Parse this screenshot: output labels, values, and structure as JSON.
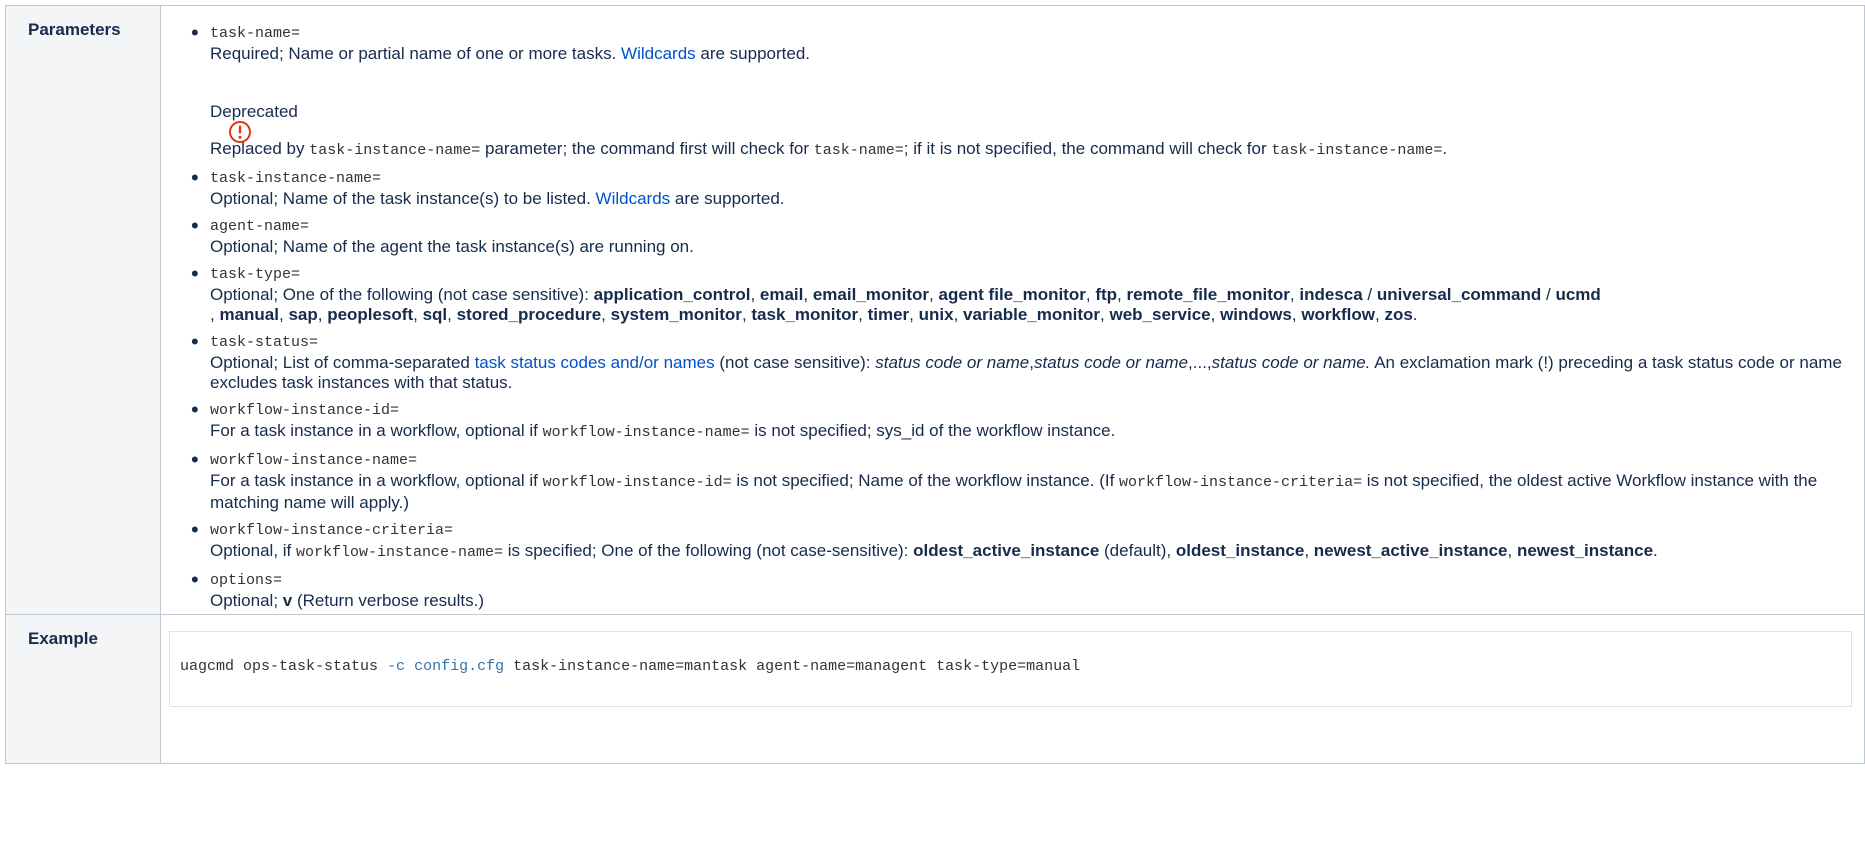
{
  "labels": {
    "parameters": "Parameters",
    "example": "Example"
  },
  "params": {
    "task_name": {
      "name": "task-name=",
      "desc_before": "Required; Name or partial name of one or more tasks. ",
      "link": "Wildcards",
      "desc_after": " are supported."
    },
    "deprecated": {
      "title": "Deprecated",
      "text1": "Replaced by ",
      "code1": "task-instance-name=",
      "text2": " parameter; the command first will check for ",
      "code2": "task-name=",
      "text3": "; if it is not specified, the command will check for ",
      "code3": "task-instance-name=",
      "text4": "."
    },
    "task_instance_name": {
      "name": "task-instance-name=",
      "desc_before": "Optional; Name of the task instance(s) to be listed. ",
      "link": "Wildcards",
      "desc_after": " are supported."
    },
    "agent_name": {
      "name": "agent-name=",
      "desc": "Optional; Name of the agent the task instance(s) are running on."
    },
    "task_type": {
      "name": "task-type=",
      "intro": "Optional; One of the following (not case sensitive): ",
      "values": [
        "application_control",
        "email",
        "email_monitor",
        "agent file_monitor",
        "ftp",
        "remote_file_monitor",
        "indesca",
        "universal_command",
        "ucmd",
        "manual",
        "sap",
        "peoplesoft",
        "sql",
        "stored_procedure",
        "system_monitor",
        "task_monitor",
        "timer",
        "unix",
        "variable_monitor",
        "web_service",
        "windows",
        "workflow",
        "zos"
      ]
    },
    "task_status": {
      "name": "task-status=",
      "desc_before": "Optional; List of comma-separated ",
      "link": "task status codes and/or names",
      "desc_mid": " (not case sensitive): ",
      "ital1": "status code or name",
      "sep1": ",",
      "ital2": "status code or name",
      "sep2": ",...,",
      "ital3": "status code or name.",
      "desc_after": " An exclamation mark (!) preceding a task status code or name excludes task instances with that status."
    },
    "workflow_instance_id": {
      "name": "workflow-instance-id=",
      "desc_before": "For a task instance in a workflow, optional if ",
      "code": "workflow-instance-name=",
      "desc_after": " is not specified; sys_id of the workflow instance."
    },
    "workflow_instance_name": {
      "name": "workflow-instance-name=",
      "desc_before": "For a task instance in a workflow, optional if ",
      "code1": "workflow-instance-id=",
      "desc_mid": " is not specified; Name of the workflow instance. (If ",
      "code2": "workflow-instance-criteria=",
      "desc_after": " is not specified, the oldest active Workflow instance with the matching name will apply.)"
    },
    "workflow_instance_criteria": {
      "name": "workflow-instance-criteria=",
      "desc_before": "Optional, if ",
      "code": "workflow-instance-name=",
      "desc_mid": " is specified; One of the following (not case-sensitive): ",
      "opt1": "oldest_active_instance",
      "opt1_note": " (default), ",
      "opt2": "oldest_instance",
      "opt3": "newest_active_instance",
      "opt4": "newest_instance",
      "end": "."
    },
    "options": {
      "name": "options=",
      "desc_before": "Optional; ",
      "val": "v",
      "desc_after": " (Return verbose results.)"
    }
  },
  "example": {
    "cmd": "uagcmd ops-task-status ",
    "flag": "-c",
    "space": " ",
    "file": "config.cfg",
    "rest": " task-instance-name=mantask agent-name=managent task-type=manual"
  },
  "icons": {
    "warning": "exclamation-circle-icon",
    "warning_color": "#de350b",
    "link_color": "#0052cc"
  }
}
